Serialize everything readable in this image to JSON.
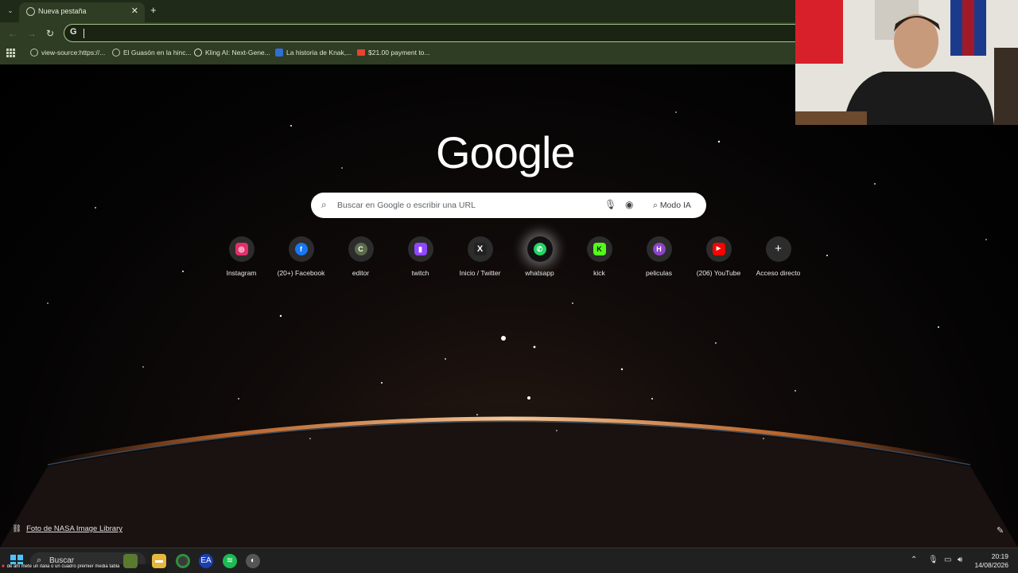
{
  "browser": {
    "tab": {
      "title": "Nueva pestaña"
    },
    "omnibox": {
      "value": ""
    },
    "bookmarks": [
      {
        "label": "view-source:https://...",
        "icon": "globe-icon",
        "color": "#bfc9b6"
      },
      {
        "label": "El Guasón en la hinc...",
        "icon": "globe-icon",
        "color": "#bfc9b6"
      },
      {
        "label": "Kling AI: Next-Gene...",
        "icon": "kling-icon",
        "color": "#e8e8e8"
      },
      {
        "label": "La historia de Knak,...",
        "icon": "kd-icon",
        "color": "#2f6fd6"
      },
      {
        "label": "$21.00 payment to...",
        "icon": "gmail-icon",
        "color": "#e94235"
      }
    ]
  },
  "ntp": {
    "logo": "Google",
    "search": {
      "placeholder": "Buscar en Google o escribir una URL",
      "ai_mode_label": "Modo IA"
    },
    "shortcuts": [
      {
        "label": "Instagram",
        "icon": "instagram-icon",
        "glyph": "◎",
        "color": "#e1306c"
      },
      {
        "label": "(20+) Facebook",
        "icon": "facebook-icon",
        "glyph": "f",
        "color": "#1877f2"
      },
      {
        "label": "editor",
        "icon": "editor-icon",
        "glyph": "C",
        "color": "#5c6b4a"
      },
      {
        "label": "twitch",
        "icon": "twitch-icon",
        "glyph": "▮",
        "color": "#9146ff"
      },
      {
        "label": "Inicio / Twitter",
        "icon": "x-icon",
        "glyph": "X",
        "color": "#222222"
      },
      {
        "label": "whatsapp",
        "icon": "whatsapp-icon",
        "glyph": "✆",
        "color": "#25d366"
      },
      {
        "label": "kick",
        "icon": "kick-icon",
        "glyph": "K",
        "color": "#53fc18"
      },
      {
        "label": "peliculas",
        "icon": "peliculas-icon",
        "glyph": "H",
        "color": "#8e44c9"
      },
      {
        "label": "(206) YouTube",
        "icon": "youtube-icon",
        "glyph": "▶",
        "color": "#ff0000"
      },
      {
        "label": "Acceso directo",
        "icon": "plus-icon",
        "glyph": "+",
        "color": "#2c2c2c"
      }
    ],
    "attribution": "Foto de NASA Image Library"
  },
  "taskbar": {
    "search_label": "Buscar",
    "ticker": "de ahi mete un italia o un cuadro premier media tabla",
    "clock_time": "20:19",
    "clock_date": "14/08/2026"
  }
}
